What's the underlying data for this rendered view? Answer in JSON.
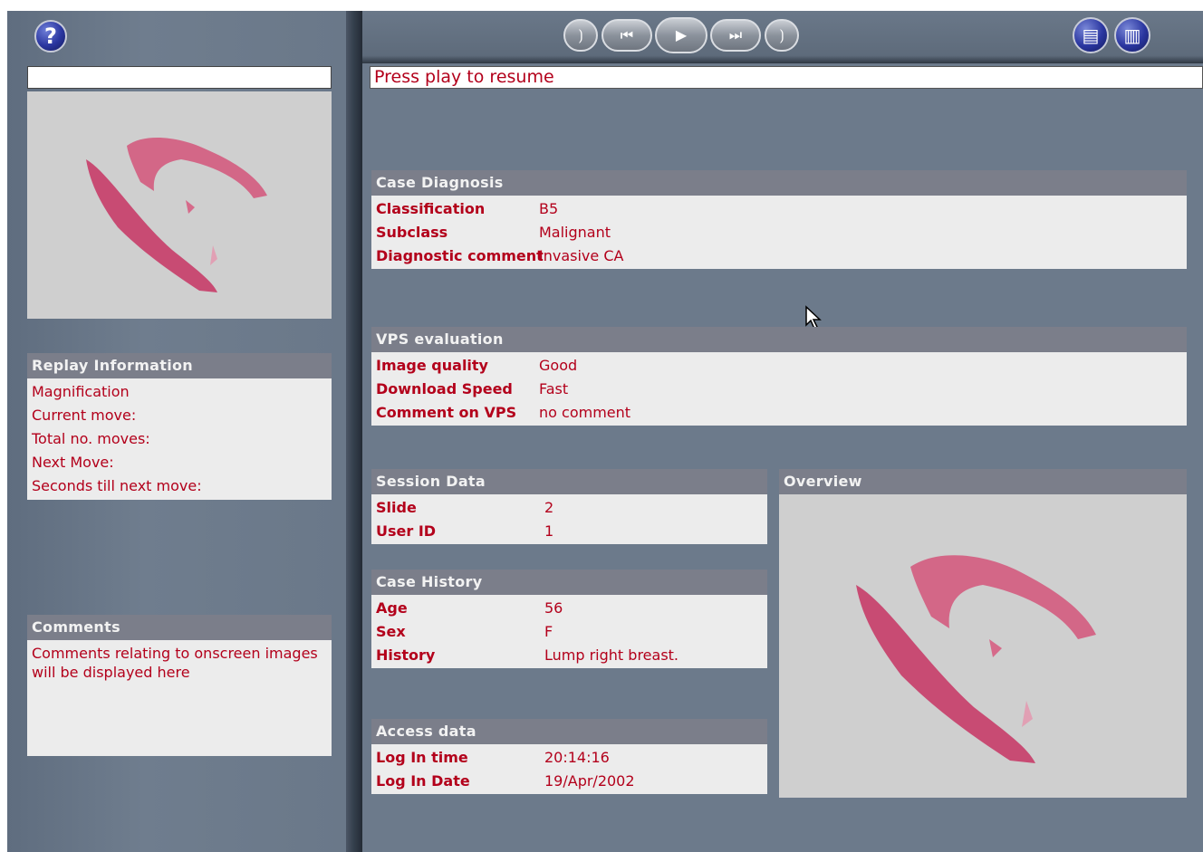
{
  "toolbar": {
    "help_label": "?",
    "controls": [
      {
        "id": "rewind-start",
        "glyph": "⟯"
      },
      {
        "id": "rewind",
        "glyph": "⏮"
      },
      {
        "id": "play",
        "glyph": "▶"
      },
      {
        "id": "fast-forward",
        "glyph": "⏭"
      },
      {
        "id": "forward-end",
        "glyph": "⟯"
      }
    ],
    "doc_icons": [
      "document-icon",
      "documents-icon"
    ]
  },
  "status_message": "Press play to resume",
  "replay_info": {
    "title": "Replay Information",
    "items": [
      "Magnification",
      "Current move:",
      "Total no. moves:",
      "Next Move:",
      "Seconds till next move:"
    ]
  },
  "comments": {
    "title": "Comments",
    "text": "Comments relating to onscreen images will be displayed here"
  },
  "case_diagnosis": {
    "title": "Case Diagnosis",
    "rows": [
      {
        "key": "Classification",
        "value": "B5"
      },
      {
        "key": "Subclass",
        "value": "Malignant"
      },
      {
        "key": "Diagnostic comment",
        "value": "Invasive CA"
      }
    ]
  },
  "vps_evaluation": {
    "title": "VPS evaluation",
    "rows": [
      {
        "key": "Image quality",
        "value": "Good"
      },
      {
        "key": "Download Speed",
        "value": "Fast"
      },
      {
        "key": "Comment on VPS",
        "value": "no comment"
      }
    ]
  },
  "session_data": {
    "title": "Session Data",
    "rows": [
      {
        "key": "Slide",
        "value": "2"
      },
      {
        "key": "User ID",
        "value": "1"
      }
    ]
  },
  "case_history": {
    "title": "Case History",
    "rows": [
      {
        "key": "Age",
        "value": "56"
      },
      {
        "key": "Sex",
        "value": "F"
      },
      {
        "key": "History",
        "value": "Lump right breast."
      }
    ]
  },
  "access_data": {
    "title": "Access data",
    "rows": [
      {
        "key": "Log In time",
        "value": "20:14:16"
      },
      {
        "key": "Log In Date",
        "value": "19/Apr/2002"
      }
    ]
  },
  "overview": {
    "title": "Overview"
  },
  "colors": {
    "accent_text": "#b3001b",
    "panel_header": "#7b7e8a",
    "background": "#6c7a8b"
  }
}
